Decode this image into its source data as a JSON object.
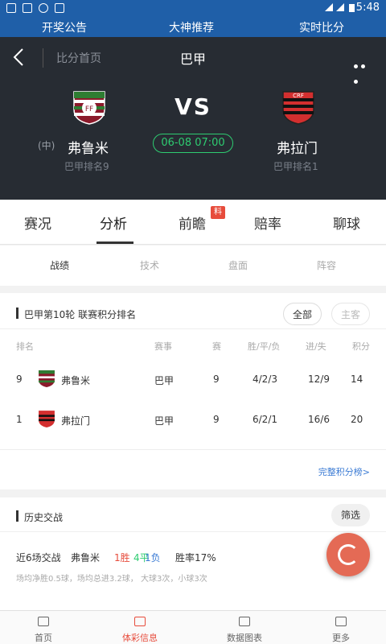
{
  "status_bar": {
    "time": "5:48"
  },
  "top_tabs": [
    "开奖公告",
    "大神推荐",
    "实时比分"
  ],
  "header": {
    "breadcrumb": "比分首页",
    "league": "巴甲",
    "vs": "VS",
    "neutral": "(中)",
    "home": {
      "name": "弗鲁米",
      "rank": "巴甲排名9"
    },
    "away": {
      "name": "弗拉门",
      "rank": "巴甲排名1"
    },
    "datetime": "06-08 07:00"
  },
  "main_tabs": [
    "赛况",
    "分析",
    "前瞻",
    "赔率",
    "聊球"
  ],
  "main_tab_badge": "料",
  "sub_tabs": [
    "战绩",
    "技术",
    "盘面",
    "阵容"
  ],
  "standings": {
    "title": "巴甲第10轮 联赛积分排名",
    "filter_all": "全部",
    "filter_home": "主客",
    "headers": [
      "排名",
      "赛事",
      "赛",
      "胜/平/负",
      "进/失",
      "积分"
    ],
    "rows": [
      {
        "rank": "9",
        "team": "弗鲁米",
        "league": "巴甲",
        "played": "9",
        "wdl": "4/2/3",
        "gf_ga": "12/9",
        "points": "14"
      },
      {
        "rank": "1",
        "team": "弗拉门",
        "league": "巴甲",
        "played": "9",
        "wdl": "6/2/1",
        "gf_ga": "16/6",
        "points": "20"
      }
    ],
    "full_link": "完整积分榜>"
  },
  "history": {
    "title": "历史交战",
    "filter": "筛选",
    "summary_prefix": "近6场交战",
    "team": "弗鲁米",
    "win": "1胜",
    "draw": "4平",
    "loss": "1负",
    "rate": "胜率17%",
    "detail": "场均净胜0.5球，场均总进3.2球， 大球3次，小球3次"
  },
  "bottom_nav": [
    "首页",
    "体彩信息",
    "数据图表",
    "更多"
  ],
  "colors": {
    "primary_blue": "#1f5fa8",
    "dark_header": "#272c33",
    "accent_green": "#2ecc71",
    "accent_red": "#e74c3c"
  }
}
